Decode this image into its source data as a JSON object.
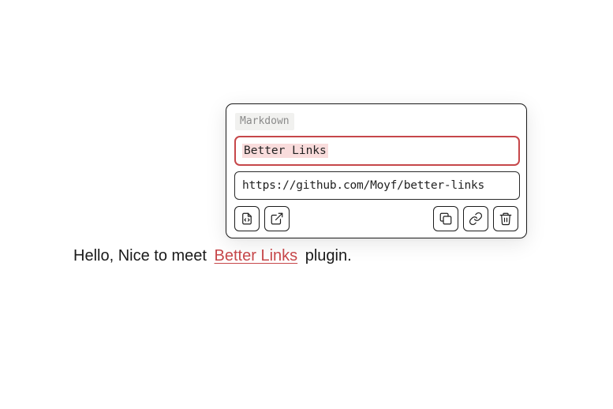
{
  "popover": {
    "tag_label": "Markdown",
    "title_value": "Better Links",
    "url_value": "https://github.com/Moyf/better-links",
    "buttons": {
      "left": [
        {
          "name": "file-code-icon"
        },
        {
          "name": "external-link-icon"
        }
      ],
      "right": [
        {
          "name": "copy-icon"
        },
        {
          "name": "link-icon"
        },
        {
          "name": "trash-icon"
        }
      ]
    }
  },
  "content": {
    "prefix": "Hello, Nice to meet",
    "link_text": "Better Links",
    "suffix": "plugin."
  },
  "colors": {
    "accent": "#c6474a",
    "selection": "#f9dcdc",
    "tag_bg": "#f1f1ef"
  }
}
